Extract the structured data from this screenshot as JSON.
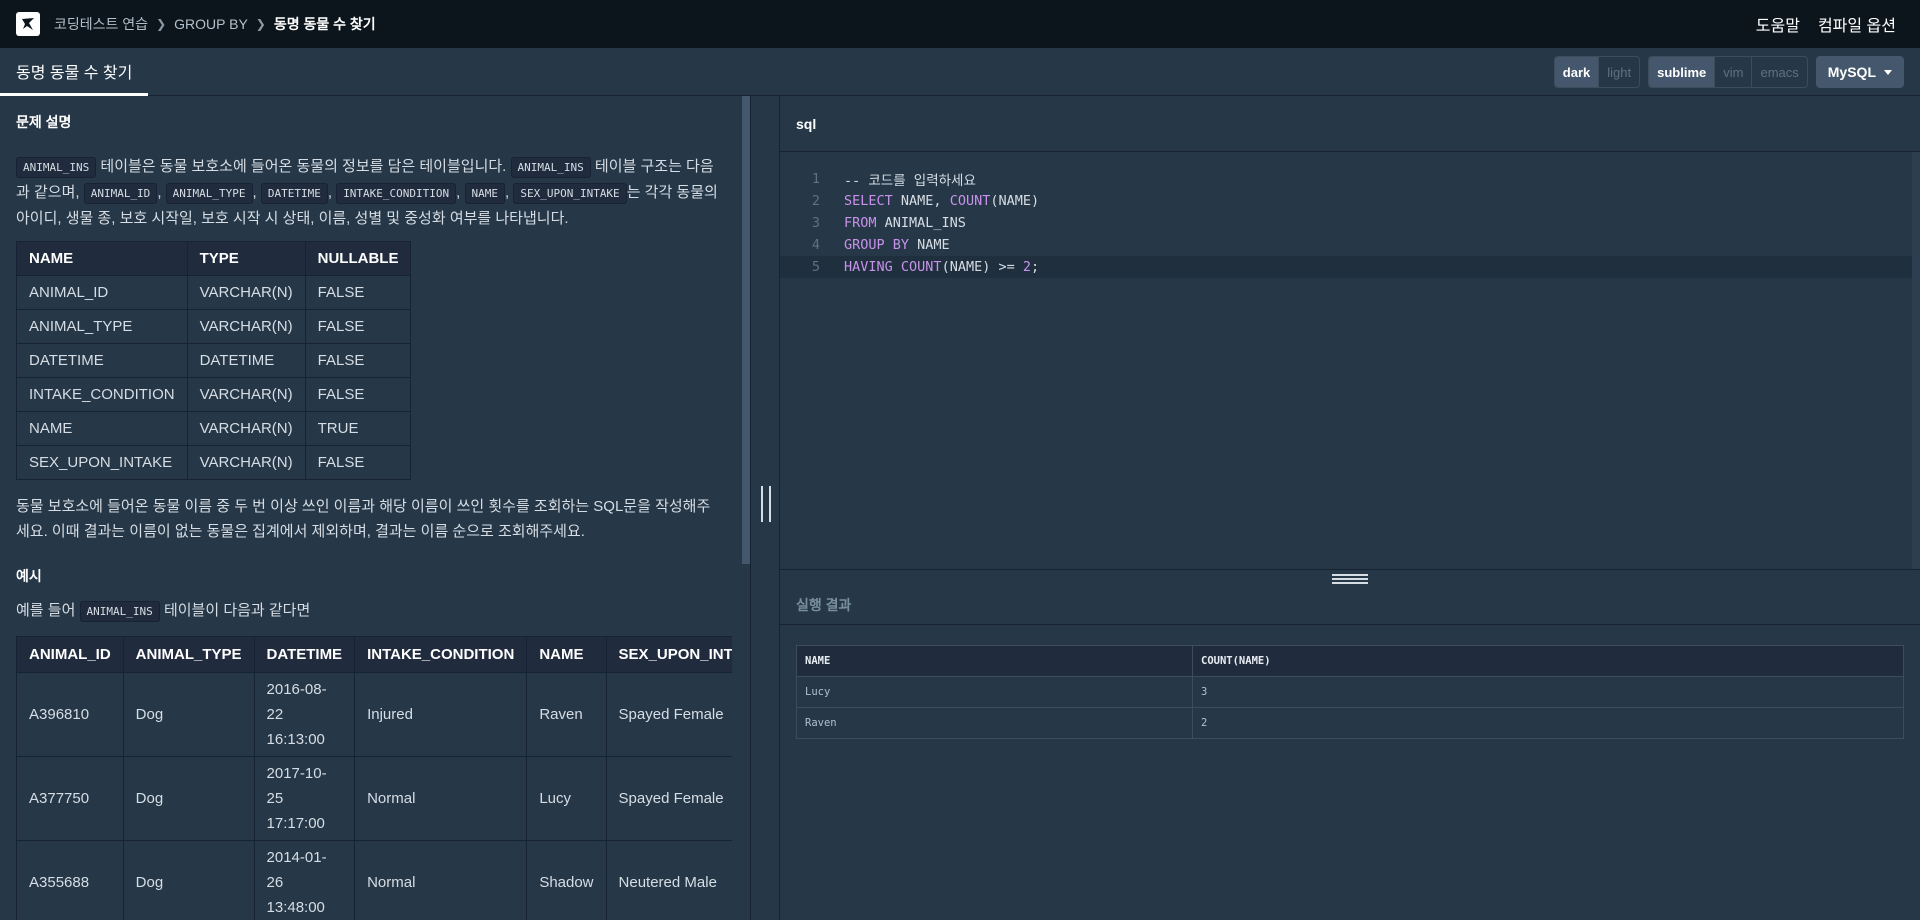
{
  "topbar": {
    "breadcrumb": [
      "코딩테스트 연습",
      "GROUP BY",
      "동명 동물 수 찾기"
    ],
    "help": "도움말",
    "compile_options": "컴파일 옵션"
  },
  "subbar": {
    "tab_title": "동명 동물 수 찾기",
    "theme": [
      "dark",
      "light"
    ],
    "keymap": [
      "sublime",
      "vim",
      "emacs"
    ],
    "language": "MySQL"
  },
  "problem": {
    "section_title": "문제 설명",
    "intro": {
      "code1": "ANIMAL_INS",
      "t1": " 테이블은 동물 보호소에 들어온 동물의 정보를 담은 테이블입니다. ",
      "code2": "ANIMAL_INS",
      "t2": " 테이블 구조는 다음과 같으며, ",
      "cols": [
        "ANIMAL_ID",
        "ANIMAL_TYPE",
        "DATETIME",
        "INTAKE_CONDITION",
        "NAME",
        "SEX_UPON_INTAKE"
      ],
      "sep": ", ",
      "t3": "는 각각 동물의 아이디, 생물 종, 보호 시작일, 보호 시작 시 상태, 이름, 성별 및 중성화 여부를 나타냅니다."
    },
    "schema": {
      "headers": [
        "NAME",
        "TYPE",
        "NULLABLE"
      ],
      "rows": [
        [
          "ANIMAL_ID",
          "VARCHAR(N)",
          "FALSE"
        ],
        [
          "ANIMAL_TYPE",
          "VARCHAR(N)",
          "FALSE"
        ],
        [
          "DATETIME",
          "DATETIME",
          "FALSE"
        ],
        [
          "INTAKE_CONDITION",
          "VARCHAR(N)",
          "FALSE"
        ],
        [
          "NAME",
          "VARCHAR(N)",
          "TRUE"
        ],
        [
          "SEX_UPON_INTAKE",
          "VARCHAR(N)",
          "FALSE"
        ]
      ]
    },
    "task": "동물 보호소에 들어온 동물 이름 중 두 번 이상 쓰인 이름과 해당 이름이 쓰인 횟수를 조회하는 SQL문을 작성해주세요. 이때 결과는 이름이 없는 동물은 집계에서 제외하며, 결과는 이름 순으로 조회해주세요.",
    "example_title": "예시",
    "example_intro_before": "예를 들어 ",
    "example_code": "ANIMAL_INS",
    "example_intro_after": " 테이블이 다음과 같다면",
    "example_table": {
      "headers": [
        "ANIMAL_ID",
        "ANIMAL_TYPE",
        "DATETIME",
        "INTAKE_CONDITION",
        "NAME",
        "SEX_UPON_INTAKE"
      ],
      "rows": [
        [
          "A396810",
          "Dog",
          "2016-08-22 16:13:00",
          "Injured",
          "Raven",
          "Spayed Female"
        ],
        [
          "A377750",
          "Dog",
          "2017-10-25 17:17:00",
          "Normal",
          "Lucy",
          "Spayed Female"
        ],
        [
          "A355688",
          "Dog",
          "2014-01-26 13:48:00",
          "Normal",
          "Shadow",
          "Neutered Male"
        ]
      ]
    }
  },
  "editor": {
    "title": "sql",
    "lines": [
      "-- 코드를 입력하세요",
      "SELECT NAME, COUNT(NAME)",
      "FROM ANIMAL_INS",
      "GROUP BY NAME",
      "HAVING COUNT(NAME) >= 2;"
    ],
    "line_numbers": [
      "1",
      "2",
      "3",
      "4",
      "5"
    ]
  },
  "result": {
    "title": "실행 결과",
    "headers": [
      "NAME",
      "COUNT(NAME)"
    ],
    "rows": [
      [
        "Lucy",
        "3"
      ],
      [
        "Raven",
        "2"
      ]
    ]
  }
}
